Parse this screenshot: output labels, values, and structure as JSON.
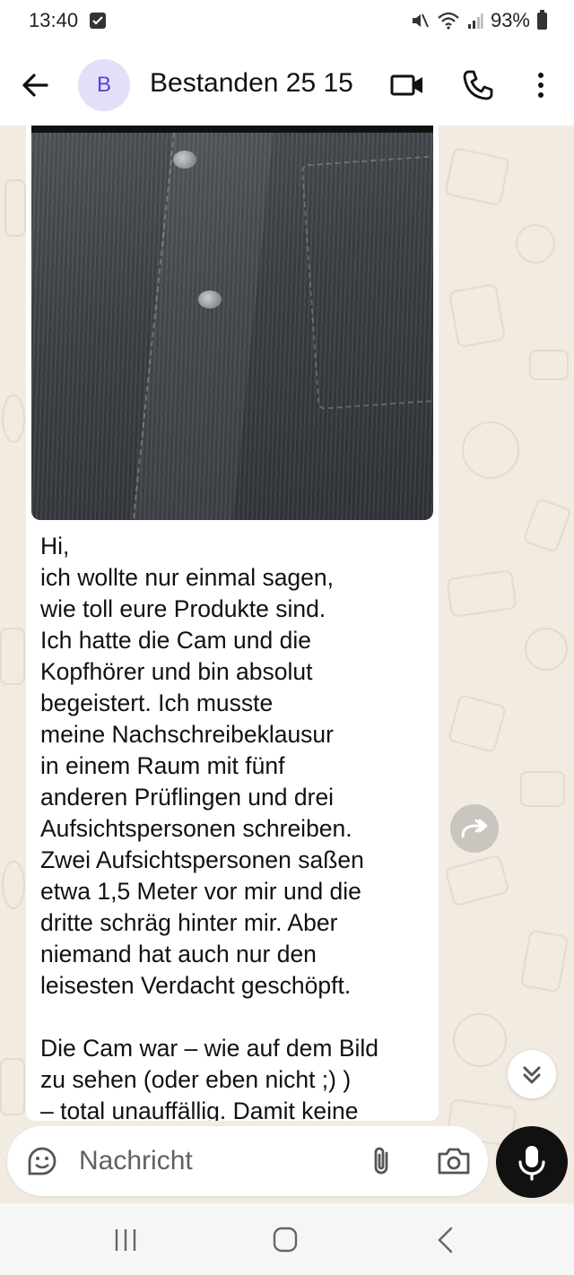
{
  "status_bar": {
    "time": "13:40",
    "battery": "93%"
  },
  "header": {
    "avatar_letter": "B",
    "title": "Bestanden 25 15"
  },
  "message": {
    "text": "Hi,\nich wollte nur einmal sagen,\nwie toll eure Produkte sind.\nIch hatte die Cam und die\nKopfhörer und bin absolut\nbegeistert. Ich musste\nmeine Nachschreibeklausur\nin einem Raum mit fünf\nanderen Prüflingen und drei\nAufsichtspersonen schreiben.\nZwei Aufsichtspersonen saßen\netwa 1,5 Meter vor mir und die\ndritte schräg hinter mir. Aber\nniemand hat auch nur den\nleisesten Verdacht geschöpft.\n\nDie Cam war – wie auf dem Bild\nzu sehen (oder eben nicht ;) )\n– total unauffällig. Damit keine"
  },
  "composer": {
    "placeholder": "Nachricht"
  },
  "colors": {
    "wallpaper": "#f1ebe1",
    "avatar_bg": "#e4def9",
    "avatar_fg": "#5a43c9",
    "mic_bg": "#111111"
  },
  "icons": {
    "back": "arrow-left-icon",
    "video": "video-call-icon",
    "phone": "phone-icon",
    "menu": "more-vert-icon",
    "forward": "forward-icon",
    "scroll": "chevrons-down-icon",
    "sticker": "sticker-icon",
    "attach": "paperclip-icon",
    "camera": "camera-icon",
    "mic": "mic-icon"
  }
}
